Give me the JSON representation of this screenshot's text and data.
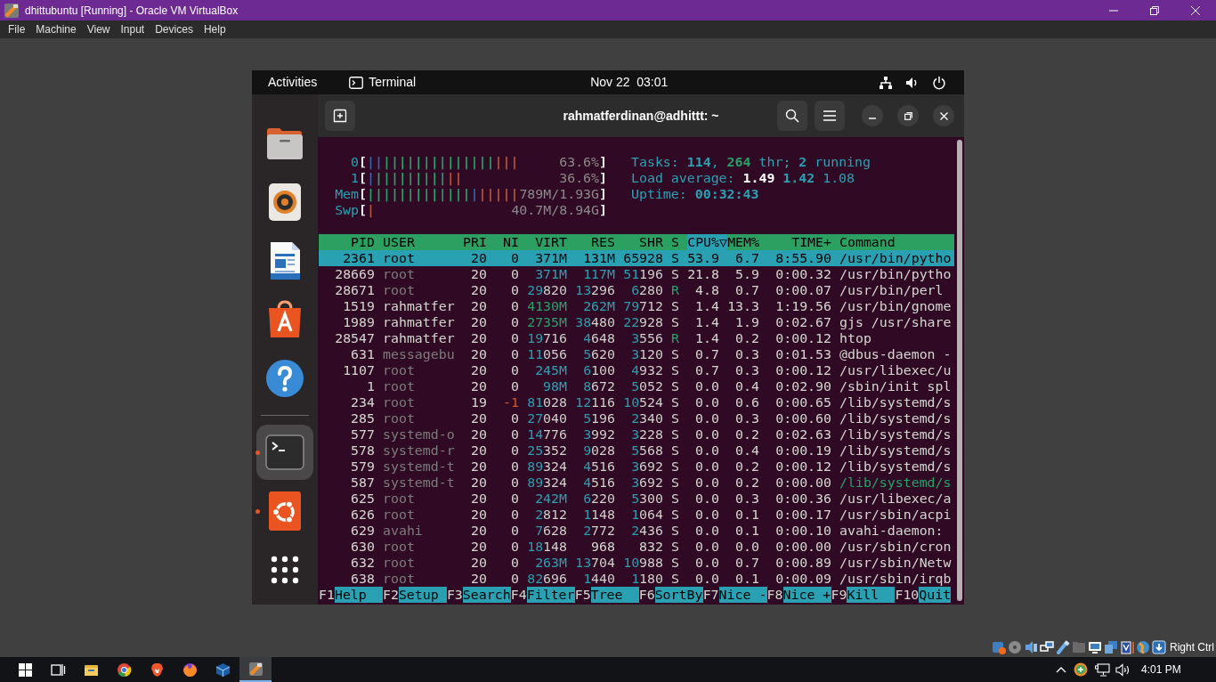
{
  "window": {
    "title": "dhittubuntu [Running] - Oracle VM VirtualBox"
  },
  "menu": [
    {
      "label": "File"
    },
    {
      "label": "Machine"
    },
    {
      "label": "View"
    },
    {
      "label": "Input"
    },
    {
      "label": "Devices"
    },
    {
      "label": "Help"
    }
  ],
  "gnome_topbar": {
    "activities": "Activities",
    "app": "Terminal",
    "clock": "Nov 22  03:01"
  },
  "dock": [
    {
      "kind": "files",
      "selected": false,
      "running": false
    },
    {
      "kind": "music",
      "selected": false,
      "running": false
    },
    {
      "kind": "writer",
      "selected": false,
      "running": false
    },
    {
      "kind": "appcenter",
      "selected": false,
      "running": false
    },
    {
      "kind": "help",
      "selected": false,
      "running": false
    },
    {
      "kind": "terminal",
      "selected": true,
      "running": true
    },
    {
      "kind": "ubuntu",
      "selected": false,
      "running": true
    },
    {
      "kind": "apps",
      "selected": false,
      "running": false
    }
  ],
  "terminal": {
    "title": "rahmatferdinan@adhittt: ~",
    "meters": [
      {
        "label": "0",
        "open": "[",
        "reading": "63.6%",
        "close": "]",
        "segments": [
          {
            "kind": "low",
            "text": "||"
          },
          {
            "kind": "normal",
            "text": "||||||||||||||"
          },
          {
            "kind": "kernel",
            "text": "|||"
          }
        ]
      },
      {
        "label": "1",
        "open": "[",
        "reading": "36.6%",
        "close": "]",
        "segments": [
          {
            "kind": "low",
            "text": "|"
          },
          {
            "kind": "normal",
            "text": "|||||||||"
          },
          {
            "kind": "kernel",
            "text": "||"
          }
        ]
      },
      {
        "label": "Mem",
        "open": "[",
        "reading": "789M/1.93G",
        "close": "]",
        "segments": [
          {
            "kind": "used",
            "text": "|||||||||||||"
          },
          {
            "kind": "buffers",
            "text": "|"
          },
          {
            "kind": "cache",
            "text": "|||||"
          }
        ]
      },
      {
        "label": "Swp",
        "open": "[",
        "reading": "40.7M/8.94G",
        "close": "]",
        "segments": [
          {
            "kind": "swap",
            "text": "|"
          }
        ]
      }
    ],
    "summary": [
      {
        "segments": [
          {
            "text": "Tasks: ",
            "kind": "label"
          },
          {
            "text": "114",
            "kind": "value"
          },
          {
            "text": ", ",
            "kind": "label"
          },
          {
            "text": "264",
            "kind": "green"
          },
          {
            "text": " thr; ",
            "kind": "label"
          },
          {
            "text": "2",
            "kind": "value"
          },
          {
            "text": " running",
            "kind": "label"
          }
        ]
      },
      {
        "segments": [
          {
            "text": "Load average: ",
            "kind": "label"
          },
          {
            "text": "1.49",
            "kind": "bright"
          },
          {
            "text": " 1.42",
            "kind": "value"
          },
          {
            "text": " 1.08",
            "kind": "label"
          }
        ]
      },
      {
        "segments": [
          {
            "text": "Uptime: ",
            "kind": "label"
          },
          {
            "text": "00:32:43",
            "kind": "value"
          }
        ]
      }
    ],
    "columns": [
      {
        "label": "PID",
        "selected": false
      },
      {
        "label": "USER",
        "selected": false
      },
      {
        "label": "PRI",
        "selected": false
      },
      {
        "label": "NI",
        "selected": false
      },
      {
        "label": "VIRT",
        "selected": false
      },
      {
        "label": "RES",
        "selected": false
      },
      {
        "label": "SHR",
        "selected": false
      },
      {
        "label": "S",
        "selected": false
      },
      {
        "label": "CPU%▽",
        "selected": true
      },
      {
        "label": "MEM%",
        "selected": false
      },
      {
        "label": "TIME+",
        "selected": false
      },
      {
        "label": "Command",
        "selected": false
      }
    ],
    "rows": [
      {
        "cells": [
          "2361",
          "root",
          "20",
          "0",
          "371M",
          "131M",
          "65928",
          "S",
          "53.9",
          "6.7",
          "8:55.90",
          "/usr/bin/pytho"
        ],
        "selected": true
      },
      {
        "cells": [
          "28669",
          "root",
          "20",
          "0",
          "371M",
          "117M",
          "51196",
          "S",
          "21.8",
          "5.9",
          "0:00.32",
          "/usr/bin/pytho"
        ],
        "selected": false,
        "system_user": true,
        "running": false,
        "niced": false,
        "thread": false
      },
      {
        "cells": [
          "28671",
          "root",
          "20",
          "0",
          "29820",
          "13296",
          "6280",
          "R",
          "4.8",
          "0.7",
          "0:00.07",
          "/usr/bin/perl"
        ],
        "selected": false,
        "system_user": true,
        "running": true,
        "niced": false,
        "thread": false
      },
      {
        "cells": [
          "1519",
          "rahmatfer",
          "20",
          "0",
          "4130M",
          "262M",
          "79712",
          "S",
          "1.4",
          "13.3",
          "1:19.56",
          "/usr/bin/gnome"
        ],
        "selected": false,
        "system_user": false,
        "running": false,
        "niced": false,
        "thread": false
      },
      {
        "cells": [
          "1989",
          "rahmatfer",
          "20",
          "0",
          "2735M",
          "38480",
          "22928",
          "S",
          "1.4",
          "1.9",
          "0:02.67",
          "gjs /usr/share"
        ],
        "selected": false,
        "system_user": false,
        "running": false,
        "niced": false,
        "thread": false
      },
      {
        "cells": [
          "28547",
          "rahmatfer",
          "20",
          "0",
          "19716",
          "4648",
          "3556",
          "R",
          "1.4",
          "0.2",
          "0:00.12",
          "htop"
        ],
        "selected": false,
        "system_user": false,
        "running": true,
        "niced": false,
        "thread": false
      },
      {
        "cells": [
          "631",
          "messagebu",
          "20",
          "0",
          "11056",
          "5620",
          "3120",
          "S",
          "0.7",
          "0.3",
          "0:01.53",
          "@dbus-daemon -"
        ],
        "selected": false,
        "system_user": true,
        "running": false,
        "niced": false,
        "thread": false
      },
      {
        "cells": [
          "1107",
          "root",
          "20",
          "0",
          "245M",
          "6100",
          "4932",
          "S",
          "0.7",
          "0.3",
          "0:00.12",
          "/usr/libexec/u"
        ],
        "selected": false,
        "system_user": true,
        "running": false,
        "niced": false,
        "thread": false
      },
      {
        "cells": [
          "1",
          "root",
          "20",
          "0",
          "98M",
          "8672",
          "5052",
          "S",
          "0.0",
          "0.4",
          "0:02.90",
          "/sbin/init spl"
        ],
        "selected": false,
        "system_user": true,
        "running": false,
        "niced": false,
        "thread": false
      },
      {
        "cells": [
          "234",
          "root",
          "19",
          "-1",
          "81028",
          "12116",
          "10524",
          "S",
          "0.0",
          "0.6",
          "0:00.65",
          "/lib/systemd/s"
        ],
        "selected": false,
        "system_user": true,
        "running": false,
        "niced": true,
        "thread": false
      },
      {
        "cells": [
          "285",
          "root",
          "20",
          "0",
          "27040",
          "5196",
          "2340",
          "S",
          "0.0",
          "0.3",
          "0:00.60",
          "/lib/systemd/s"
        ],
        "selected": false,
        "system_user": true,
        "running": false,
        "niced": false,
        "thread": false
      },
      {
        "cells": [
          "577",
          "systemd-o",
          "20",
          "0",
          "14776",
          "3992",
          "3228",
          "S",
          "0.0",
          "0.2",
          "0:02.63",
          "/lib/systemd/s"
        ],
        "selected": false,
        "system_user": true,
        "running": false,
        "niced": false,
        "thread": false
      },
      {
        "cells": [
          "578",
          "systemd-r",
          "20",
          "0",
          "25352",
          "9028",
          "5568",
          "S",
          "0.0",
          "0.4",
          "0:00.19",
          "/lib/systemd/s"
        ],
        "selected": false,
        "system_user": true,
        "running": false,
        "niced": false,
        "thread": false
      },
      {
        "cells": [
          "579",
          "systemd-t",
          "20",
          "0",
          "89324",
          "4516",
          "3692",
          "S",
          "0.0",
          "0.2",
          "0:00.12",
          "/lib/systemd/s"
        ],
        "selected": false,
        "system_user": true,
        "running": false,
        "niced": false,
        "thread": false
      },
      {
        "cells": [
          "587",
          "systemd-t",
          "20",
          "0",
          "89324",
          "4516",
          "3692",
          "S",
          "0.0",
          "0.2",
          "0:00.00",
          "/lib/systemd/s"
        ],
        "selected": false,
        "system_user": true,
        "running": false,
        "niced": false,
        "thread": true
      },
      {
        "cells": [
          "625",
          "root",
          "20",
          "0",
          "242M",
          "6220",
          "5300",
          "S",
          "0.0",
          "0.3",
          "0:00.36",
          "/usr/libexec/a"
        ],
        "selected": false,
        "system_user": true,
        "running": false,
        "niced": false,
        "thread": false
      },
      {
        "cells": [
          "626",
          "root",
          "20",
          "0",
          "2812",
          "1148",
          "1064",
          "S",
          "0.0",
          "0.1",
          "0:00.17",
          "/usr/sbin/acpi"
        ],
        "selected": false,
        "system_user": true,
        "running": false,
        "niced": false,
        "thread": false
      },
      {
        "cells": [
          "629",
          "avahi",
          "20",
          "0",
          "7628",
          "2772",
          "2436",
          "S",
          "0.0",
          "0.1",
          "0:00.10",
          "avahi-daemon:"
        ],
        "selected": false,
        "system_user": true,
        "running": false,
        "niced": false,
        "thread": false
      },
      {
        "cells": [
          "630",
          "root",
          "20",
          "0",
          "18148",
          "968",
          "832",
          "S",
          "0.0",
          "0.0",
          "0:00.00",
          "/usr/sbin/cron"
        ],
        "selected": false,
        "system_user": true,
        "running": false,
        "niced": false,
        "thread": false
      },
      {
        "cells": [
          "632",
          "root",
          "20",
          "0",
          "263M",
          "13704",
          "10988",
          "S",
          "0.0",
          "0.7",
          "0:00.89",
          "/usr/sbin/Netw"
        ],
        "selected": false,
        "system_user": true,
        "running": false,
        "niced": false,
        "thread": false
      },
      {
        "cells": [
          "638",
          "root",
          "20",
          "0",
          "82696",
          "1440",
          "1180",
          "S",
          "0.0",
          "0.1",
          "0:00.09",
          "/usr/sbin/irqb"
        ],
        "selected": false,
        "system_user": true,
        "running": false,
        "niced": false,
        "thread": false
      }
    ],
    "function_keys": [
      {
        "key": "F1",
        "label": "Help"
      },
      {
        "key": "F2",
        "label": "Setup"
      },
      {
        "key": "F3",
        "label": "Search"
      },
      {
        "key": "F4",
        "label": "Filter"
      },
      {
        "key": "F5",
        "label": "Tree"
      },
      {
        "key": "F6",
        "label": "SortBy"
      },
      {
        "key": "F7",
        "label": "Nice -"
      },
      {
        "key": "F8",
        "label": "Nice +"
      },
      {
        "key": "F9",
        "label": "Kill"
      },
      {
        "key": "F10",
        "label": "Quit"
      }
    ]
  },
  "status_bar": {
    "host_key": "Right Ctrl"
  },
  "taskbar": {
    "apps": [
      {
        "kind": "start",
        "selected": false
      },
      {
        "kind": "taskview",
        "selected": false
      },
      {
        "kind": "explorer",
        "selected": false
      },
      {
        "kind": "chrome",
        "selected": false
      },
      {
        "kind": "brave",
        "selected": false
      },
      {
        "kind": "firefox",
        "selected": false
      },
      {
        "kind": "cube",
        "selected": false
      },
      {
        "kind": "vm",
        "selected": true
      }
    ],
    "clock": "4:01 PM"
  }
}
